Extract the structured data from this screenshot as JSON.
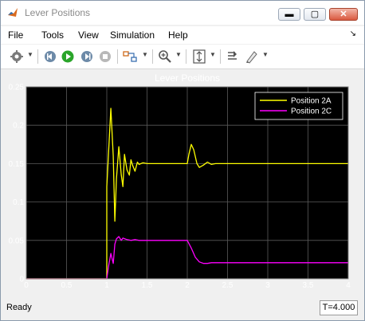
{
  "window": {
    "title": "Lever Positions",
    "minimize_glyph": "▬",
    "maximize_glyph": "▢",
    "close_glyph": "✕"
  },
  "menu": {
    "items": [
      {
        "label": "File"
      },
      {
        "label": "Tools"
      },
      {
        "label": "View"
      },
      {
        "label": "Simulation"
      },
      {
        "label": "Help"
      }
    ],
    "collapse_glyph": "↘"
  },
  "toolbar": {
    "buttons": [
      {
        "name": "settings-icon"
      },
      {
        "name": "step-back-icon"
      },
      {
        "name": "run-icon"
      },
      {
        "name": "step-forward-icon"
      },
      {
        "name": "stop-icon"
      },
      {
        "name": "highlight-block-icon"
      },
      {
        "name": "zoom-in-icon"
      },
      {
        "name": "autoscale-icon"
      },
      {
        "name": "cursor-measurements-icon"
      },
      {
        "name": "style-icon"
      }
    ]
  },
  "colors": {
    "plot_background": "#000000",
    "figure_background": "#f0f0f0",
    "axis_text": "#ffffff",
    "grid": "#5a5a5a",
    "series_2a": "#ffff00",
    "series_2c": "#ff00ff",
    "run_green": "#2aa52a"
  },
  "chart_data": {
    "type": "line",
    "title": "Lever Positions",
    "xlabel": "",
    "ylabel": "",
    "xlim": [
      0,
      4
    ],
    "ylim": [
      0,
      0.25
    ],
    "xticks": [
      "0",
      "0.5",
      "1",
      "1.5",
      "2",
      "2.5",
      "3",
      "3.5",
      "4"
    ],
    "yticks": [
      "0",
      "0.05",
      "0.1",
      "0.15",
      "0.2",
      "0.25"
    ],
    "grid": true,
    "legend_position": "top-right",
    "series": [
      {
        "name": "Position 2A",
        "color": "#ffff00",
        "x": [
          0,
          1.0,
          1.0,
          1.05,
          1.08,
          1.1,
          1.12,
          1.15,
          1.18,
          1.2,
          1.22,
          1.25,
          1.28,
          1.3,
          1.32,
          1.35,
          1.38,
          1.4,
          1.45,
          1.5,
          2.0,
          2.02,
          2.05,
          2.08,
          2.12,
          2.15,
          2.2,
          2.25,
          2.3,
          2.35,
          2.4,
          2.5,
          4.0
        ],
        "y": [
          0,
          0,
          0.12,
          0.222,
          0.16,
          0.075,
          0.13,
          0.172,
          0.135,
          0.12,
          0.162,
          0.142,
          0.135,
          0.155,
          0.148,
          0.14,
          0.152,
          0.149,
          0.151,
          0.15,
          0.15,
          0.162,
          0.175,
          0.168,
          0.15,
          0.145,
          0.148,
          0.152,
          0.149,
          0.15,
          0.15,
          0.15,
          0.15
        ]
      },
      {
        "name": "Position 2C",
        "color": "#ff00ff",
        "x": [
          0,
          1.0,
          1.02,
          1.05,
          1.08,
          1.1,
          1.12,
          1.15,
          1.18,
          1.2,
          1.25,
          1.3,
          1.35,
          1.4,
          1.5,
          2.0,
          2.05,
          2.1,
          2.15,
          2.2,
          2.25,
          2.3,
          2.4,
          4.0
        ],
        "y": [
          0,
          0,
          0.015,
          0.033,
          0.02,
          0.045,
          0.052,
          0.055,
          0.05,
          0.053,
          0.051,
          0.05,
          0.051,
          0.05,
          0.05,
          0.05,
          0.04,
          0.028,
          0.022,
          0.02,
          0.02,
          0.021,
          0.021,
          0.021
        ]
      }
    ]
  },
  "status": {
    "text": "Ready",
    "time": "T=4.000"
  }
}
